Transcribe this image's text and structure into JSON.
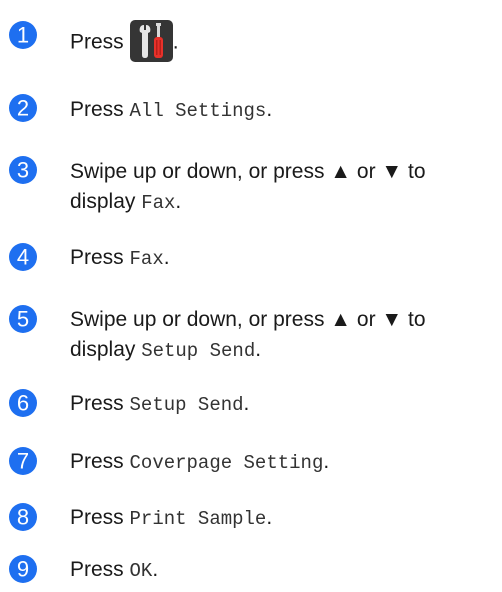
{
  "accent_color": "#1e6ff0",
  "steps": [
    {
      "number": "1",
      "parts": [
        {
          "t": "Press"
        },
        {
          "icon": "tools-icon"
        },
        {
          "t": "."
        }
      ]
    },
    {
      "number": "2",
      "parts": [
        {
          "t": "Press "
        },
        {
          "m": "All Settings"
        },
        {
          "t": "."
        }
      ]
    },
    {
      "number": "3",
      "parts": [
        {
          "t": "Swipe up or down, or press ▲ or ▼ to"
        },
        {
          "br": true
        },
        {
          "t": "display "
        },
        {
          "m": "Fax"
        },
        {
          "t": "."
        }
      ]
    },
    {
      "number": "4",
      "parts": [
        {
          "t": "Press "
        },
        {
          "m": "Fax"
        },
        {
          "t": "."
        }
      ]
    },
    {
      "number": "5",
      "parts": [
        {
          "t": "Swipe up or down, or press ▲ or ▼ to"
        },
        {
          "br": true
        },
        {
          "t": "display "
        },
        {
          "m": "Setup Send"
        },
        {
          "t": "."
        }
      ]
    },
    {
      "number": "6",
      "parts": [
        {
          "t": "Press "
        },
        {
          "m": "Setup Send"
        },
        {
          "t": "."
        }
      ]
    },
    {
      "number": "7",
      "parts": [
        {
          "t": "Press "
        },
        {
          "m": "Coverpage Setting"
        },
        {
          "t": "."
        }
      ]
    },
    {
      "number": "8",
      "parts": [
        {
          "t": "Press "
        },
        {
          "m": "Print Sample"
        },
        {
          "t": "."
        }
      ]
    },
    {
      "number": "9",
      "parts": [
        {
          "t": "Press "
        },
        {
          "m": "OK"
        },
        {
          "t": "."
        }
      ]
    }
  ]
}
